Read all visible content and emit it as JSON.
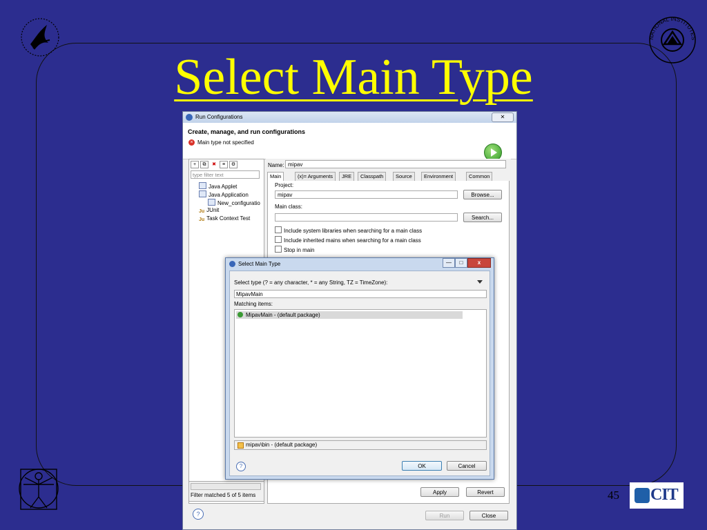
{
  "slide": {
    "title": "Select Main Type",
    "page_number": "45",
    "logo_right_text": "CIT",
    "seal_right_text": "NATIONAL INSTITUTES OF HEALTH",
    "colors": {
      "background": "#2c2d8f",
      "title": "#ffff00"
    }
  },
  "run_config": {
    "title": "Run Configurations",
    "close": "✕",
    "header_title": "Create, manage, and run configurations",
    "error_message": "Main type not specified",
    "filter_placeholder": "type filter text",
    "tree": [
      "Java Applet",
      "Java Application",
      "New_configuratio",
      "JUnit",
      "Task Context Test"
    ],
    "filter_status": "Filter matched 5 of 5 items",
    "name_label": "Name:",
    "name_value": "mipav",
    "tabs": [
      "Main",
      "(x)= Arguments",
      "JRE",
      "Classpath",
      "Source",
      "Environment",
      "Common"
    ],
    "project_label": "Project:",
    "project_value": "mipav",
    "browse_label": "Browse...",
    "main_class_label": "Main class:",
    "main_class_value": "",
    "search_label": "Search...",
    "checkboxes": [
      "Include system libraries when searching for a main class",
      "Include inherited mains when searching for a main class",
      "Stop in main"
    ],
    "apply_label": "Apply",
    "revert_label": "Revert",
    "run_label": "Run",
    "close_label": "Close",
    "help_glyph": "?"
  },
  "select_main_type": {
    "title": "Select Main Type",
    "prompt": "Select type (? = any character, * = any String, TZ = TimeZone):",
    "input_value": "MipavMain",
    "matching_label": "Matching items:",
    "items": [
      "MipavMain - (default package)"
    ],
    "package": "mipav\\bin - (default package)",
    "ok_label": "OK",
    "cancel_label": "Cancel",
    "help_glyph": "?",
    "min_glyph": "—",
    "max_glyph": "□",
    "close_glyph": "x"
  }
}
